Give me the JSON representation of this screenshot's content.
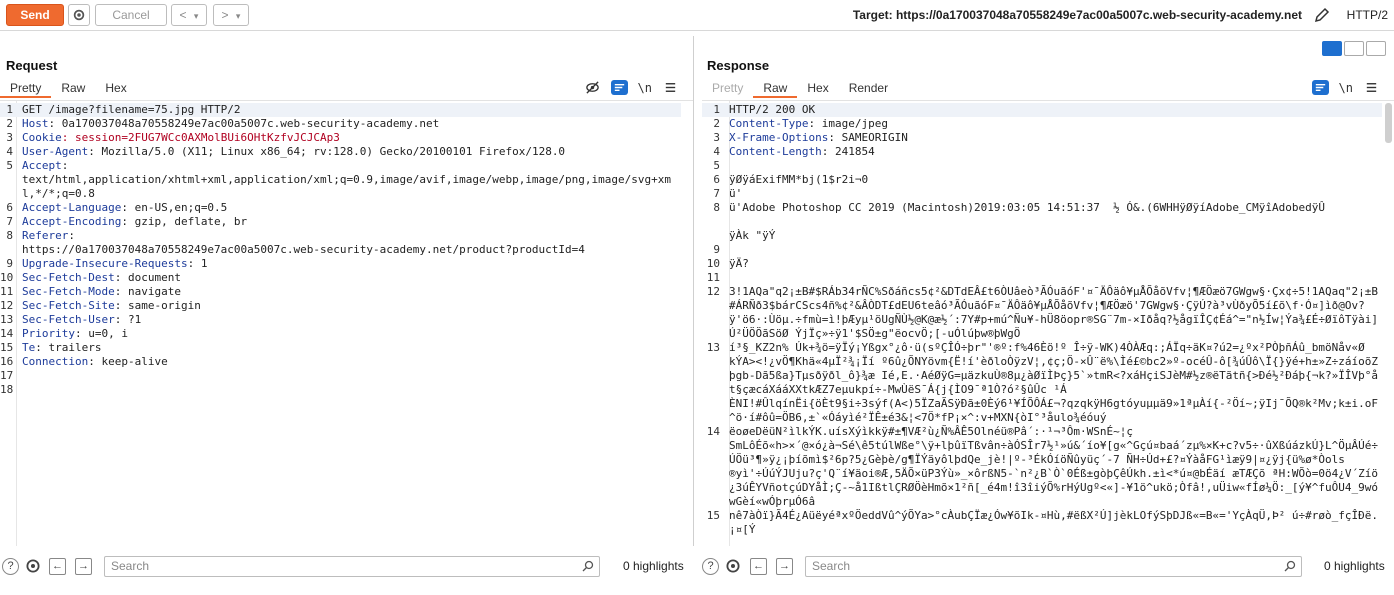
{
  "toolbar": {
    "send_label": "Send",
    "cancel_label": "Cancel",
    "back_label": "<",
    "back_menu": "▾",
    "forward_label": ">",
    "forward_menu": "▾",
    "target_text": "Target: https://0a170037048a70558249e7ac00a5007c.web-security-academy.net",
    "protocol": "HTTP/2"
  },
  "request": {
    "title": "Request",
    "tabs": [
      "Pretty",
      "Raw",
      "Hex"
    ],
    "active_tab": "Pretty",
    "newline_toggle": "\\n",
    "lines": [
      {
        "n": "1",
        "text": "GET /image?filename=75.jpg HTTP/2"
      },
      {
        "n": "2",
        "text": "Host: 0a170037048a70558249e7ac00a5007c.web-security-academy.net"
      },
      {
        "n": "3",
        "text": "Cookie: session=2FUG7WCc0AXMolBUi6OHtKzfvJCJCAp3"
      },
      {
        "n": "4",
        "text": "User-Agent: Mozilla/5.0 (X11; Linux x86_64; rv:128.0) Gecko/20100101 Firefox/128.0"
      },
      {
        "n": "5",
        "text": "Accept:\ntext/html,application/xhtml+xml,application/xml;q=0.9,image/avif,image/webp,image/png,image/svg+xml,*/*;q=0.8"
      },
      {
        "n": "6",
        "text": "Accept-Language: en-US,en;q=0.5"
      },
      {
        "n": "7",
        "text": "Accept-Encoding: gzip, deflate, br"
      },
      {
        "n": "8",
        "text": "Referer:\nhttps://0a170037048a70558249e7ac00a5007c.web-security-academy.net/product?productId=4"
      },
      {
        "n": "9",
        "text": "Upgrade-Insecure-Requests: 1"
      },
      {
        "n": "10",
        "text": "Sec-Fetch-Dest: document"
      },
      {
        "n": "11",
        "text": "Sec-Fetch-Mode: navigate"
      },
      {
        "n": "12",
        "text": "Sec-Fetch-Site: same-origin"
      },
      {
        "n": "13",
        "text": "Sec-Fetch-User: ?1"
      },
      {
        "n": "14",
        "text": "Priority: u=0, i"
      },
      {
        "n": "15",
        "text": "Te: trailers"
      },
      {
        "n": "16",
        "text": "Connection: keep-alive"
      },
      {
        "n": "17",
        "text": ""
      },
      {
        "n": "18",
        "text": ""
      }
    ]
  },
  "response": {
    "title": "Response",
    "tabs": [
      "Pretty",
      "Raw",
      "Hex",
      "Render"
    ],
    "active_tab": "Raw",
    "newline_toggle": "\\n",
    "lines": [
      {
        "n": "1",
        "text": "HTTP/2 200 OK"
      },
      {
        "n": "2",
        "text": "Content-Type: image/jpeg"
      },
      {
        "n": "3",
        "text": "X-Frame-Options: SAMEORIGIN"
      },
      {
        "n": "4",
        "text": "Content-Length: 241854"
      },
      {
        "n": "5",
        "text": ""
      },
      {
        "n": "6",
        "text": "ÿØÿáExifMM*bj(1$r2i¬0"
      },
      {
        "n": "7",
        "text": "ü'"
      },
      {
        "n": "8",
        "text": "ü'Adobe Photoshop CC 2019 (Macintosh)2019:03:05 14:51:37  ½ Ó&.(6WHHÿØÿíAdobe_CMÿîAdobedÿÛ\n\nÿÀk \"ÿÝ"
      },
      {
        "n": "9",
        "text": ""
      },
      {
        "n": "10",
        "text": "ÿÄ?"
      },
      {
        "n": "11",
        "text": ""
      },
      {
        "n": "12",
        "text": "3!1AQa\"q2¡±B#$RÁb34rÑC%Sðáñcs5¢²&DTdEÂ£t6ÒUâeò³ÃÓuãóF'¤¯ÄÔäô¥µÅÕåõVfv¦¶ÆÖæö7GWgw§·Çx¢÷5!1AQaq\"2¡±B#ÁRÑð3$bárCScs4ñ%¢²&ÂÒDT£dEU6teâó³ÃÓuãóF¤¯ÄÔäô¥µÅÕåõVfv¦¶ÆÖæö'7GWgw§·ÇÿÚ?à³vÙðyÕ5í£õ\\f·Ó¤]ìð@Ov?ÿ'ö6·:Ùöµ.÷fmù=ì!þÆyµ¹öUgÑÙ½@K@æ½´:7Y#p+mú^Ñu¥-hÜ8öopr®SG¨7m-×Iðåq?½ågïÎÇ¢Éá^=\"n½Íw¦Ýa¾£É÷ØïôTÿài]Ú²ÜÖÖãSöØ ÝjÏç»÷ÿ1'$SÖ±g\"ëocvÖ;[-uÓlúþw®þWgÖ"
      },
      {
        "n": "13",
        "text": "í³§_KZ2n% Úk+¾ö=ÿÏý¡Yßgx°¿ô·ü(sºÇÎÓ÷þr\"'®º:f%46Èö!º Î÷ÿ-WK)4ÒÀÆq:;ÁÏq÷äK¤?ú2=¿ºx²PÒþñÁû_bmöNåv«Ø\nkÝA><!¿vÖ¶Khä«4µÏ²¾¡Ïí º6û¿ÕNYövm{Ë!í'èðloÒÿzV¦,¢ç;Ö-×Û¨ë%\\Ìé£©bc2»º-océÛ-ô[¾úÛô\\Ï{}ÿé+h±»Z÷záíoõZþgb-Dã5ßa}Tµsðÿðl_ô}¾æ Ié,E.·AéØÿG=µäzkuÙ®8µ¿àØïÌÞç}5`»tmR<?xáHçiSJèM#½z®ëTãtñ{>Ðé½²Ðáþ{¬k?»ÏÎVþ°åt§çæcáXááXXtkÆZ7eµukpí÷-MwÙëS¯Á{j{ÌO9¯ª1Ò?ó²§ûÛc ¹Á\nÈNI!#ÛlqínËi{öÈt9§i÷3sýf(A<)5ÏZaÃSÿÐã±0Èý6¹¥ÍÕÔÁ£¬?qzqkÿH6gtóyuµµä9»1ªµÀí{-²Öí~;ÿIj¯ÕQ®k²Mv;k±i.oF^ö·í#ôû=ÖB6,±`«Óáyìé²ÏÊ±é3&¦<7Ö*fP¡×^:v+MXN{òI°³åulo¾éóuý"
      },
      {
        "n": "14",
        "text": "ëoøeDëüN²ìlkÝK.uísXýìkkÿ#±¶VÆ²ù¿Ñ%ÂÊ5Olnéü®Pâ´:·¹¬³Ôm·WSnÉ~¦ç\nSmLôÉõ«h>×´@×ó¿à¬Sé\\ê5túlWße°\\ÿ+lþûïTßvân÷àÓSÎr7½¹»ú&´ío¥[g«^Gçú¤baá´zµ%×K+c?v5÷·ûXßúázkÚ}L^ÖµÂÚé÷ÚÖü³¶»ÿ¿¡þíõmì$²6p?5¿Gèþè/g¶ÏÝäyôlþdQe_jè!|º-³ÉkÓíöÑûyüç´-7 ÑH÷Úd+£?¤ÝàåFG¹ìæÿ9|¤¿ÿj{ü%ø*Òols\n®yì'÷ÚúÝJUju?ç'Q¨í¥äoi®Æ,5ÄÕ×üP3Ýù»_×ôrßN5-`n²¿B`Ò`0Éß±gòþÇêÚkh.±ì<*ú¤@bÉäí æTÆÇõ ªH:WÕò=0ö4¿V´Zíö¿3úÊYVñotçúDYåÌ;Ç-~å1IßtlÇRØÖèHmõ×1²ñ[_é4m!î3îiýÕ%rHýUgº<«]-¥1ö^ukö;Òfâ!,uÜiw«fÍø¼Ö:_[ý¥^fuÔU4_9wówGèí«wÓþrµÓ6â"
      },
      {
        "n": "15",
        "text": "nê7àÒï}Ã4É¿AüëyéªxºÖeddVû^ýÕYa>°cÀubÇÏæ¿Ów¥õIk-¤Hù,#ëßX²Ú]jèkLOfýSþDJß«=B«='YçÀqÜ,Þ² ú÷#røò_fçÎÐë.¡¤[Ý\n"
      }
    ]
  },
  "bottom_left": {
    "search_placeholder": "Search",
    "highlights": "0 highlights"
  },
  "bottom_right": {
    "search_placeholder": "Search",
    "highlights": "0 highlights"
  }
}
